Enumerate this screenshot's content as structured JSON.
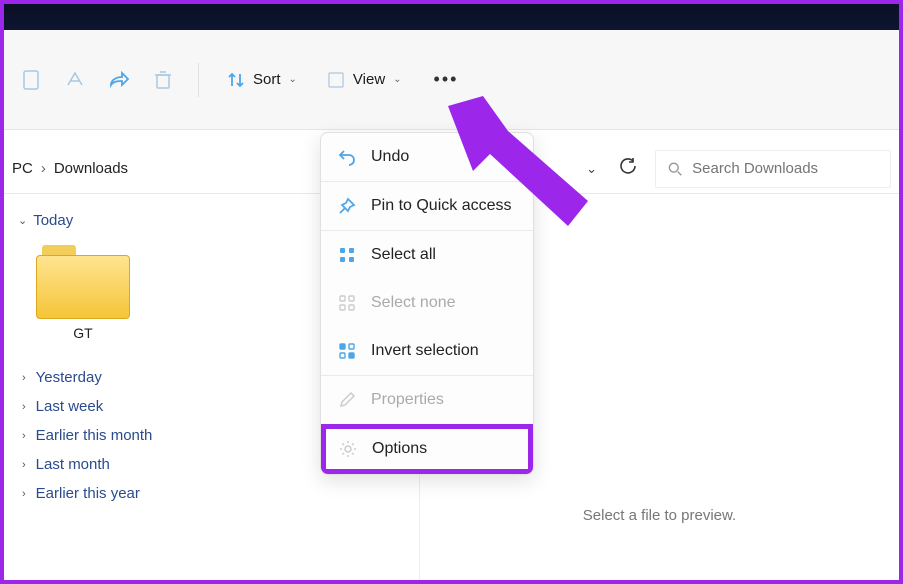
{
  "toolbar": {
    "sort_label": "Sort",
    "view_label": "View"
  },
  "breadcrumb": {
    "pc": "PC",
    "loc": "Downloads"
  },
  "search": {
    "placeholder": "Search Downloads"
  },
  "groups": {
    "today": "Today",
    "folder_name": "GT",
    "collapsed": [
      "Yesterday",
      "Last week",
      "Earlier this month",
      "Last month",
      "Earlier this year"
    ]
  },
  "menu": {
    "undo": "Undo",
    "pin": "Pin to Quick access",
    "select_all": "Select all",
    "select_none": "Select none",
    "invert": "Invert selection",
    "properties": "Properties",
    "options": "Options"
  },
  "preview": "Select a file to preview."
}
